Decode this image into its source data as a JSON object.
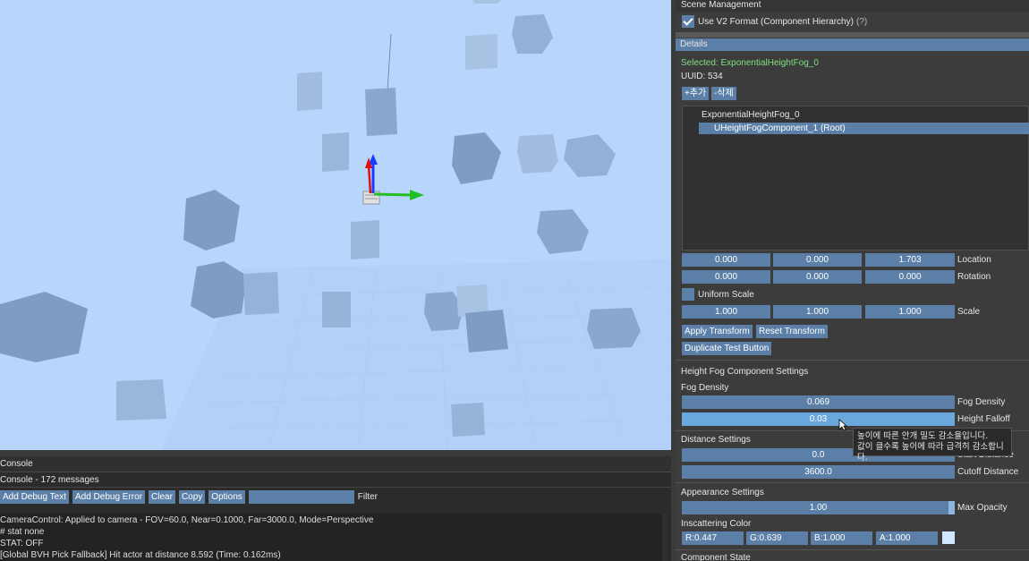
{
  "scene_management": {
    "title": "Scene Management",
    "use_v2_label": "Use V2 Format (Component Hierarchy)",
    "help": "(?)"
  },
  "details": {
    "title": "Details",
    "selected": "Selected: ExponentialHeightFog_0",
    "uuid": "UUID: 534",
    "add_label": "+추가",
    "delete_label": "-삭제",
    "tree": {
      "root": "ExponentialHeightFog_0",
      "child": "UHeightFogComponent_1 (Root)"
    },
    "location": {
      "label": "Location",
      "x": "0.000",
      "y": "0.000",
      "z": "1.703"
    },
    "rotation": {
      "label": "Rotation",
      "x": "0.000",
      "y": "0.000",
      "z": "0.000"
    },
    "uniform_scale_label": "Uniform Scale",
    "scale": {
      "label": "Scale",
      "x": "1.000",
      "y": "1.000",
      "z": "1.000"
    },
    "apply_transform": "Apply Transform",
    "reset_transform": "Reset Transform",
    "duplicate_test": "Duplicate Test Button"
  },
  "fog": {
    "section_title": "Height Fog Component Settings",
    "density_heading": "Fog Density",
    "density": {
      "value": "0.069",
      "label": "Fog Density"
    },
    "falloff": {
      "value": "0.03",
      "label": "Height Falloff"
    },
    "distance_heading": "Distance Settings",
    "start_distance": {
      "value": "0.0",
      "label": "Start Distance"
    },
    "cutoff": {
      "value": "3600.0",
      "label": "Cutoff Distance"
    },
    "appearance_heading": "Appearance Settings",
    "max_opacity": {
      "value": "1.00",
      "label": "Max Opacity"
    },
    "inscattering_heading": "Inscattering Color",
    "color": {
      "r": "R:0.447",
      "g": "G:0.639",
      "b": "B:1.000",
      "a": "A:1.000",
      "swatch": "#d2e6ff"
    },
    "component_state": "Component State"
  },
  "tooltip": {
    "line1": "높이에 따른 안개 밀도 감소율입니다.",
    "line2": "값이 클수록 높이에 따라 급격히 감소합니다."
  },
  "console": {
    "title": "Console",
    "count": "Console - 172 messages",
    "add_debug_text": "Add Debug Text",
    "add_debug_error": "Add Debug Error",
    "clear": "Clear",
    "copy": "Copy",
    "options": "Options",
    "filter_label": "Filter",
    "lines": [
      "CameraControl: Applied to camera - FOV=60.0, Near=0.1000, Far=3000.0, Mode=Perspective",
      "# stat none",
      "STAT: OFF",
      "[Global BVH Pick Fallback] Hit actor at distance 8.592 (Time: 0.162ms)"
    ]
  },
  "colors": {
    "viewport_sky": "#b8d6fb",
    "field_blue": "#5b7fa6",
    "active_field": "#6aa7dc",
    "selected_text": "#7fe07f"
  }
}
